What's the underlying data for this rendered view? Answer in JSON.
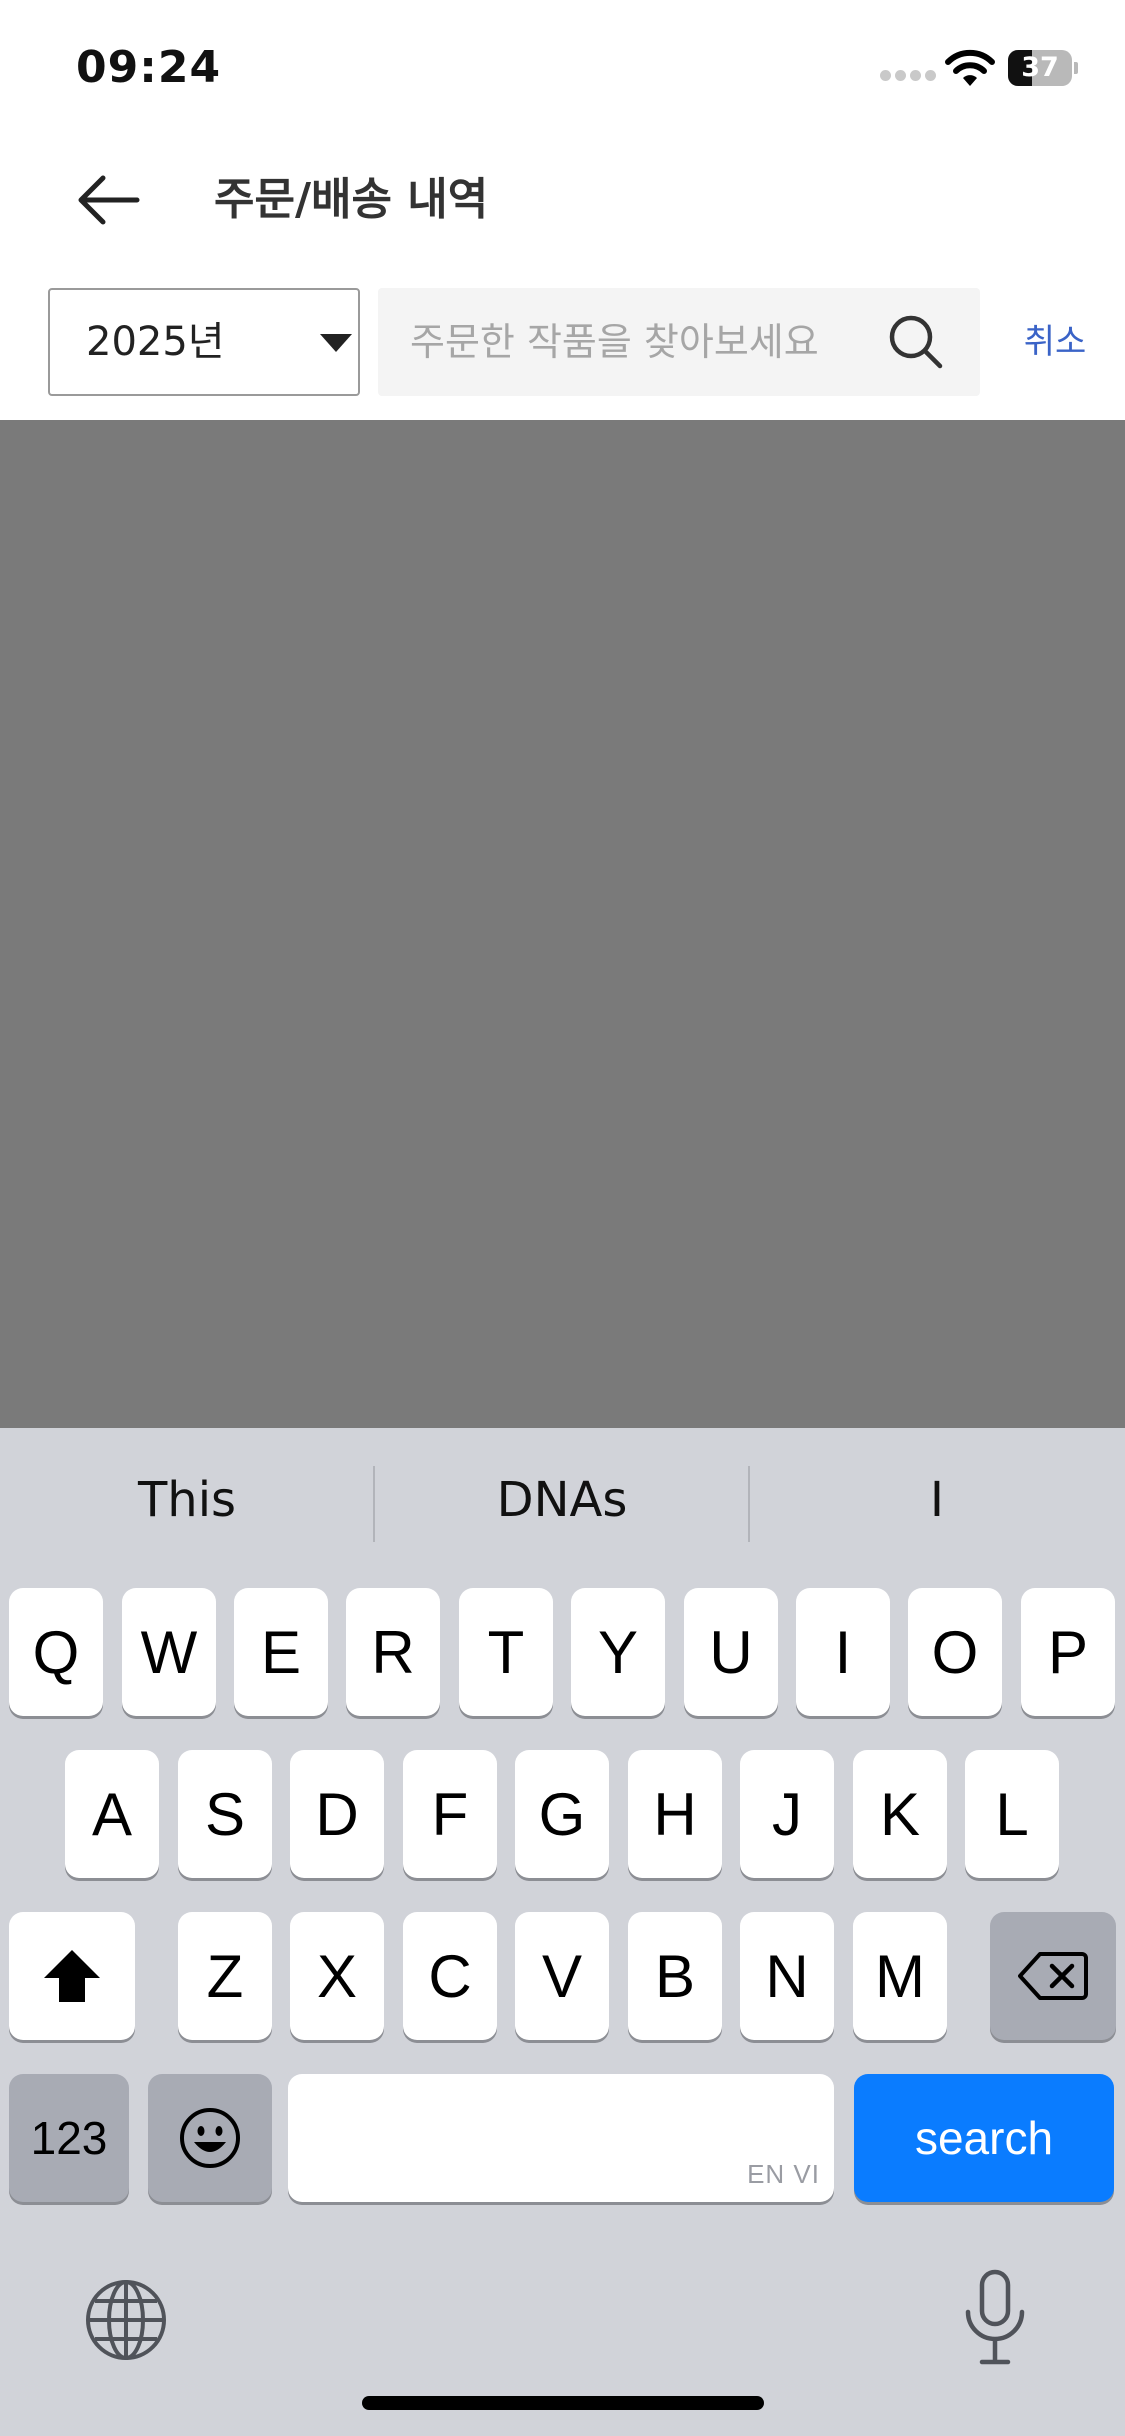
{
  "status_bar": {
    "time": "09:24",
    "battery_level": "37",
    "battery_fraction": 0.37
  },
  "header": {
    "title": "주문/배송 내역"
  },
  "search": {
    "year_value": "2025년",
    "placeholder": "주문한 작품을 찾아보세요",
    "query": "",
    "cancel_label": "취소"
  },
  "keyboard": {
    "suggestions": [
      "This",
      "DNAs",
      "I"
    ],
    "row1": [
      "Q",
      "W",
      "E",
      "R",
      "T",
      "Y",
      "U",
      "I",
      "O",
      "P"
    ],
    "row2": [
      "A",
      "S",
      "D",
      "F",
      "G",
      "H",
      "J",
      "K",
      "L"
    ],
    "row3": [
      "Z",
      "X",
      "C",
      "V",
      "B",
      "N",
      "M"
    ],
    "numbers_label": "123",
    "space_languages": "EN VI",
    "search_label": "search"
  },
  "icons": {
    "back": "arrow-left-icon",
    "dropdown": "caret-down-icon",
    "search": "search-icon",
    "shift": "shift-icon",
    "delete": "delete-icon",
    "emoji": "emoji-icon",
    "globe": "globe-icon",
    "mic": "microphone-icon"
  },
  "colors": {
    "accent": "#0a7cff",
    "cancel": "#3a63c7",
    "overlay": "#7a7a7a",
    "keyboard_bg": "#d1d3d9"
  }
}
